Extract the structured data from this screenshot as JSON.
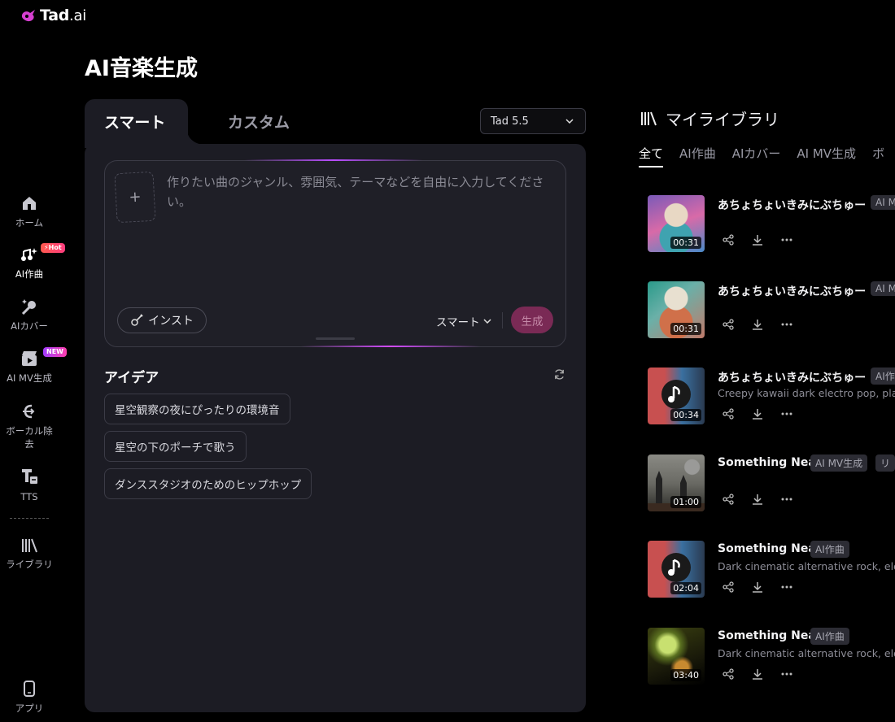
{
  "app": {
    "logo_text": "Tad",
    "logo_suffix": ".ai"
  },
  "sidebar": {
    "items": [
      {
        "label": "ホーム",
        "icon": "home-icon"
      },
      {
        "label": "AI作曲",
        "icon": "music-sparkle-icon",
        "badge": "Hot"
      },
      {
        "label": "AIカバー",
        "icon": "microphone-sparkle-icon"
      },
      {
        "label": "AI MV生成",
        "icon": "clapper-icon",
        "badge": "NEW"
      },
      {
        "label": "ボーカル除去",
        "icon": "vocal-remove-icon"
      },
      {
        "label": "TTS",
        "icon": "tts-icon"
      },
      {
        "label": "ライブラリ",
        "icon": "library-icon"
      },
      {
        "label": "アプリ",
        "icon": "phone-icon"
      }
    ]
  },
  "page": {
    "title": "AI音楽生成"
  },
  "composer": {
    "tabs": [
      "スマート",
      "カスタム"
    ],
    "model": "Tad 5.5",
    "upload_symbol": "+",
    "placeholder": "作りたい曲のジャンル、雰囲気、テーマなどを自由に入力してください。",
    "inst_label": "インスト",
    "mode_label": "スマート",
    "generate_label": "生成"
  },
  "ideas": {
    "title": "アイデア",
    "items": [
      "星空観察の夜にぴったりの環境音",
      "星空の下のポーチで歌う",
      "ダンススタジオのためのヒップホップ"
    ]
  },
  "library": {
    "title": "マイライブラリ",
    "tabs": [
      "全て",
      "AI作曲",
      "AIカバー",
      "AI MV生成",
      "ボ"
    ],
    "songs": [
      {
        "title": "あちょちょいきみにぶちゅー",
        "tags": [
          "AI M"
        ],
        "desc": "",
        "duration": "00:31"
      },
      {
        "title": "あちょちょいきみにぶちゅー",
        "tags": [
          "AI M"
        ],
        "desc": "",
        "duration": "00:31"
      },
      {
        "title": "あちょちょいきみにぶちゅー",
        "tags": [
          "AI作"
        ],
        "desc": "Creepy kawaii dark electro pop, playful",
        "duration": "00:34"
      },
      {
        "title": "Something Near",
        "tags": [
          "AI MV生成",
          "リ"
        ],
        "desc": "",
        "duration": "01:00"
      },
      {
        "title": "Something Near",
        "tags": [
          "AI作曲"
        ],
        "desc": "Dark cinematic alternative rock, electro",
        "duration": "02:04"
      },
      {
        "title": "Something Near",
        "tags": [
          "AI作曲"
        ],
        "desc": "Dark cinematic alternative rock, electro",
        "duration": "03:40"
      }
    ]
  },
  "colors": {
    "panel": "#1c1c24",
    "accent": "#b94dff",
    "generate": "#7a2a55",
    "hot": "#ff4a62",
    "new": "#c13cff"
  }
}
